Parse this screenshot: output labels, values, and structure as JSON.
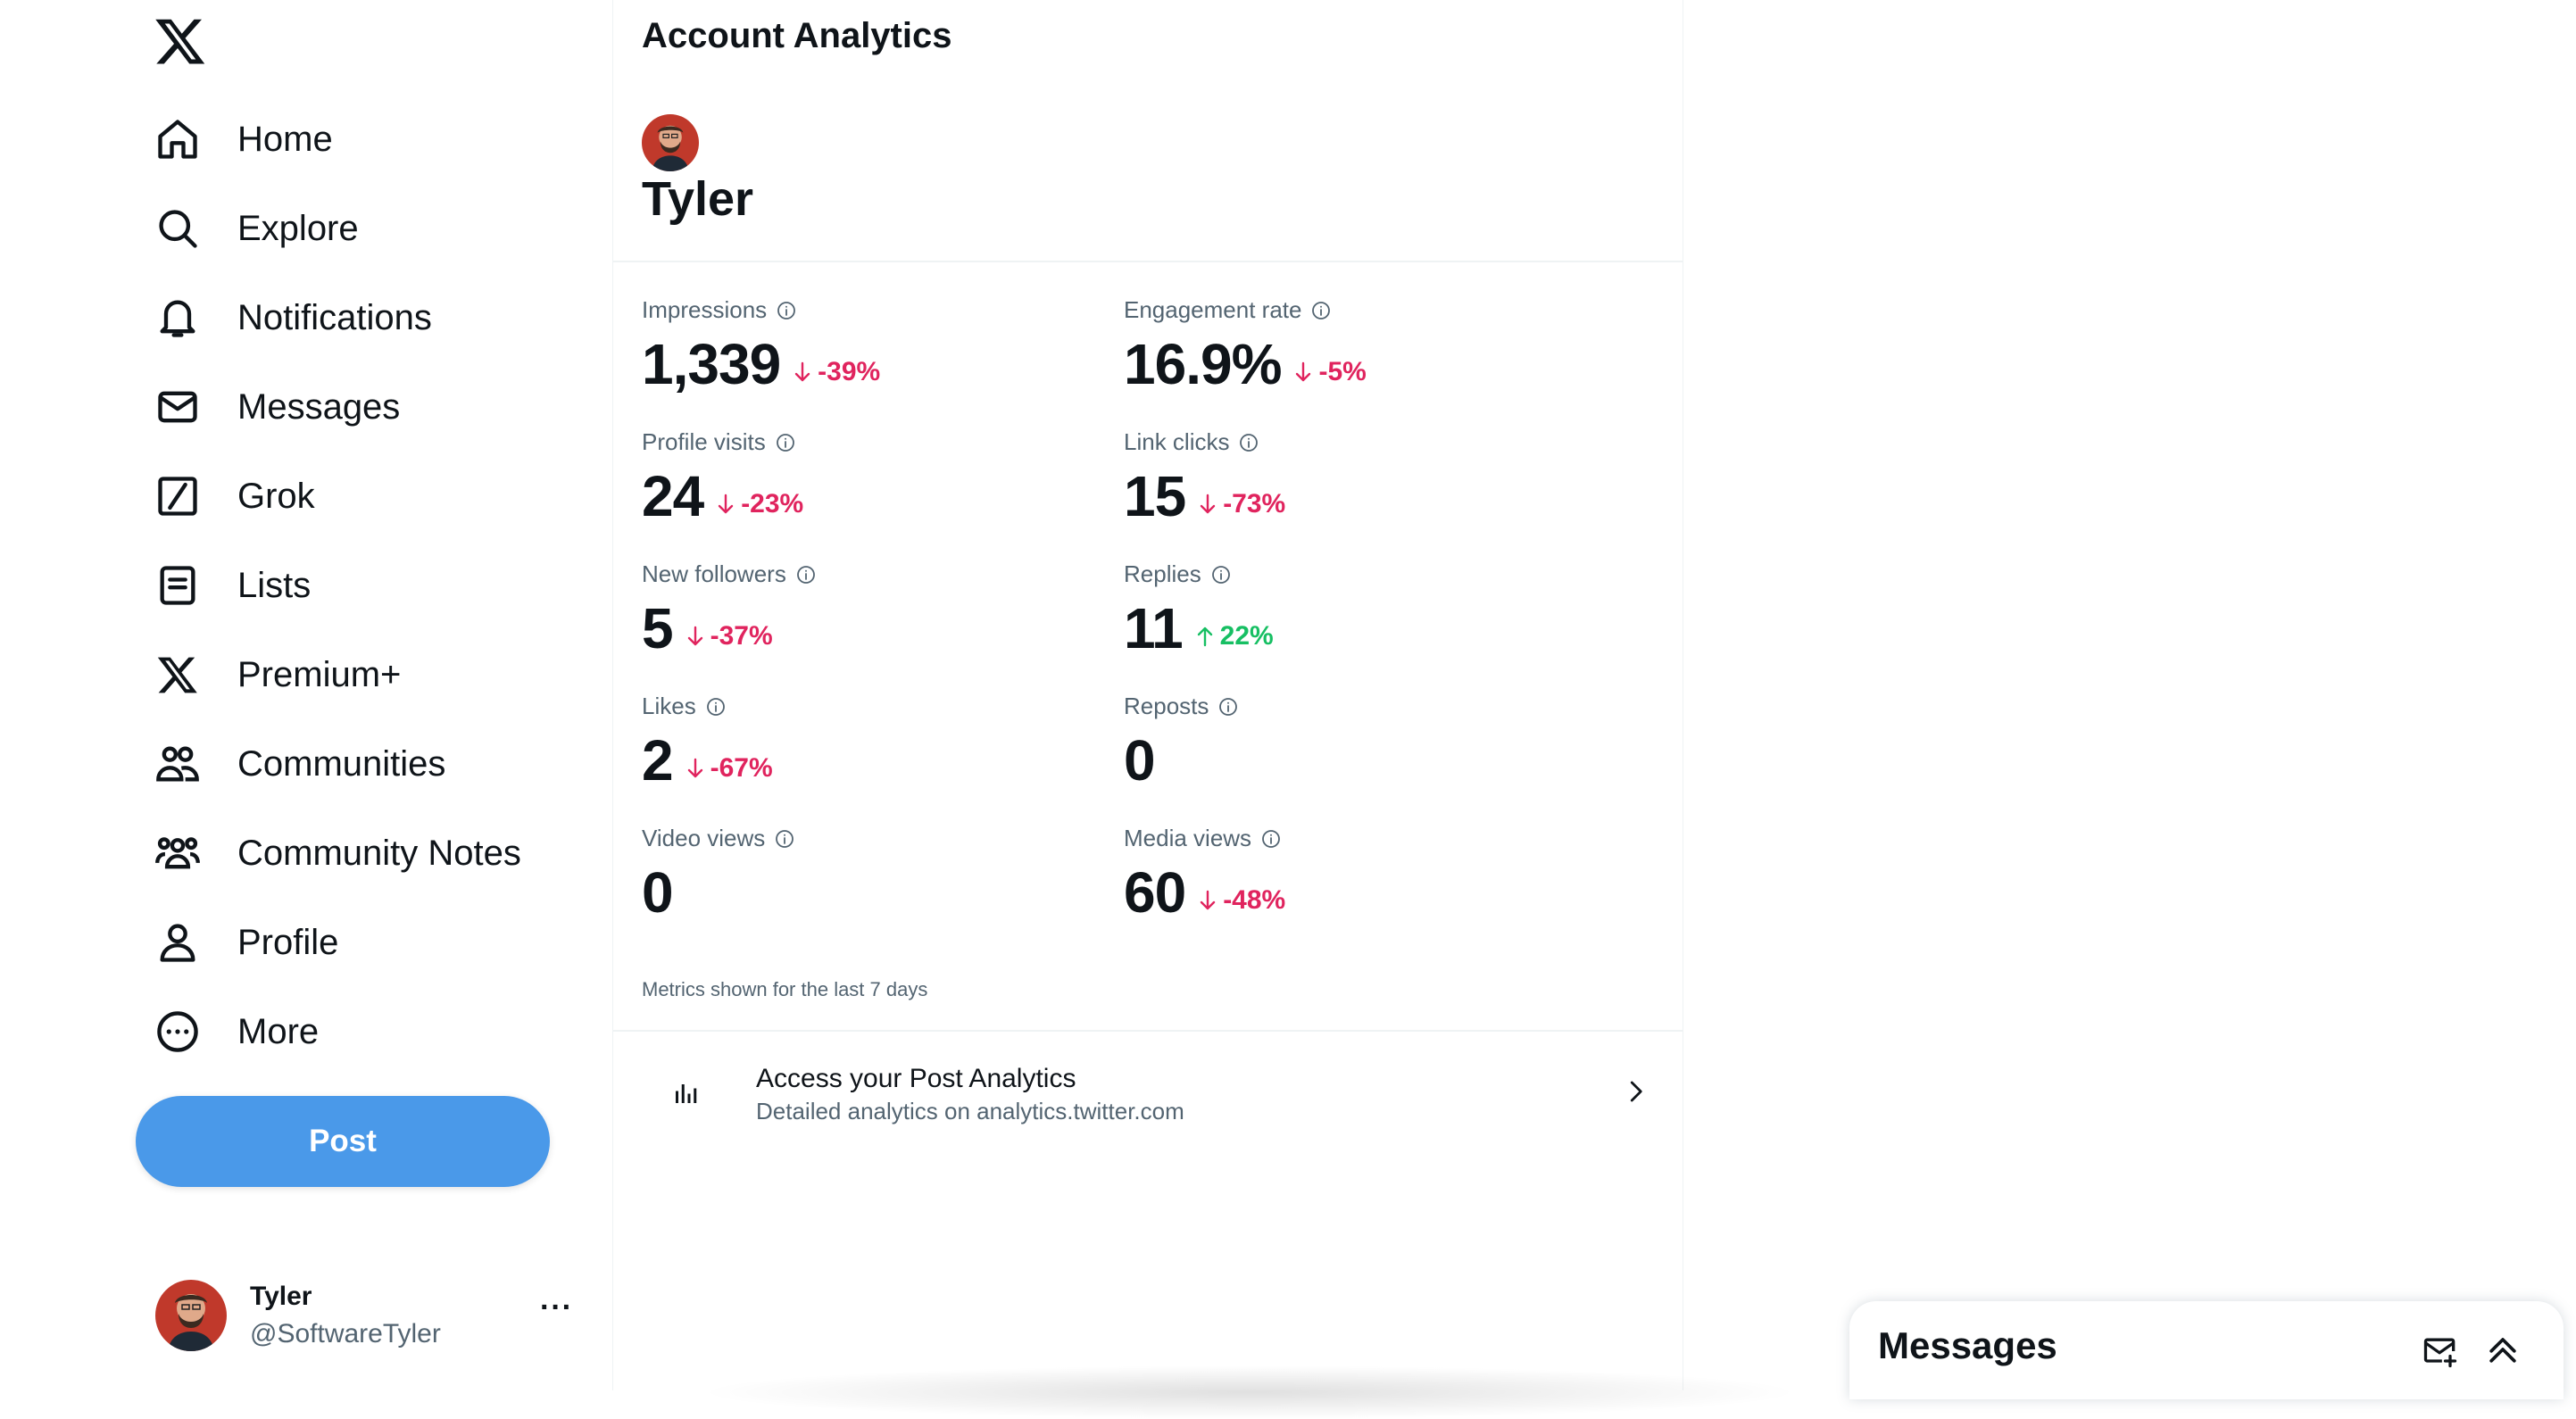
{
  "sidebar": {
    "logo_icon": "x-logo-icon",
    "items": [
      {
        "label": "Home",
        "icon": "home-icon"
      },
      {
        "label": "Explore",
        "icon": "search-icon"
      },
      {
        "label": "Notifications",
        "icon": "bell-icon"
      },
      {
        "label": "Messages",
        "icon": "envelope-icon"
      },
      {
        "label": "Grok",
        "icon": "grok-icon"
      },
      {
        "label": "Lists",
        "icon": "list-icon"
      },
      {
        "label": "Premium+",
        "icon": "x-logo-icon"
      },
      {
        "label": "Communities",
        "icon": "communities-icon"
      },
      {
        "label": "Community Notes",
        "icon": "community-notes-icon"
      },
      {
        "label": "Profile",
        "icon": "person-icon"
      },
      {
        "label": "More",
        "icon": "more-circle-icon"
      }
    ],
    "post_label": "Post",
    "account": {
      "name": "Tyler",
      "handle": "@SoftwareTyler",
      "more": "···"
    }
  },
  "main": {
    "title": "Account Analytics",
    "name": "Tyler",
    "metrics": [
      {
        "label": "Impressions",
        "value": "1,339",
        "change": "-39%",
        "direction": "down"
      },
      {
        "label": "Engagement rate",
        "value": "16.9%",
        "change": "-5%",
        "direction": "down"
      },
      {
        "label": "Profile visits",
        "value": "24",
        "change": "-23%",
        "direction": "down"
      },
      {
        "label": "Link clicks",
        "value": "15",
        "change": "-73%",
        "direction": "down"
      },
      {
        "label": "New followers",
        "value": "5",
        "change": "-37%",
        "direction": "down"
      },
      {
        "label": "Replies",
        "value": "11",
        "change": "22%",
        "direction": "up"
      },
      {
        "label": "Likes",
        "value": "2",
        "change": "-67%",
        "direction": "down"
      },
      {
        "label": "Reposts",
        "value": "0",
        "change": "",
        "direction": ""
      },
      {
        "label": "Video views",
        "value": "0",
        "change": "",
        "direction": ""
      },
      {
        "label": "Media views",
        "value": "60",
        "change": "-48%",
        "direction": "down"
      }
    ],
    "footnote": "Metrics shown for the last 7 days",
    "post_analytics": {
      "title": "Access your Post Analytics",
      "subtitle": "Detailed analytics on analytics.twitter.com"
    }
  },
  "messages_drawer": {
    "title": "Messages"
  },
  "colors": {
    "accent": "#4a99e9",
    "down": "#e0245e",
    "up": "#17bf63",
    "text": "#0f1419",
    "muted": "#536471"
  }
}
